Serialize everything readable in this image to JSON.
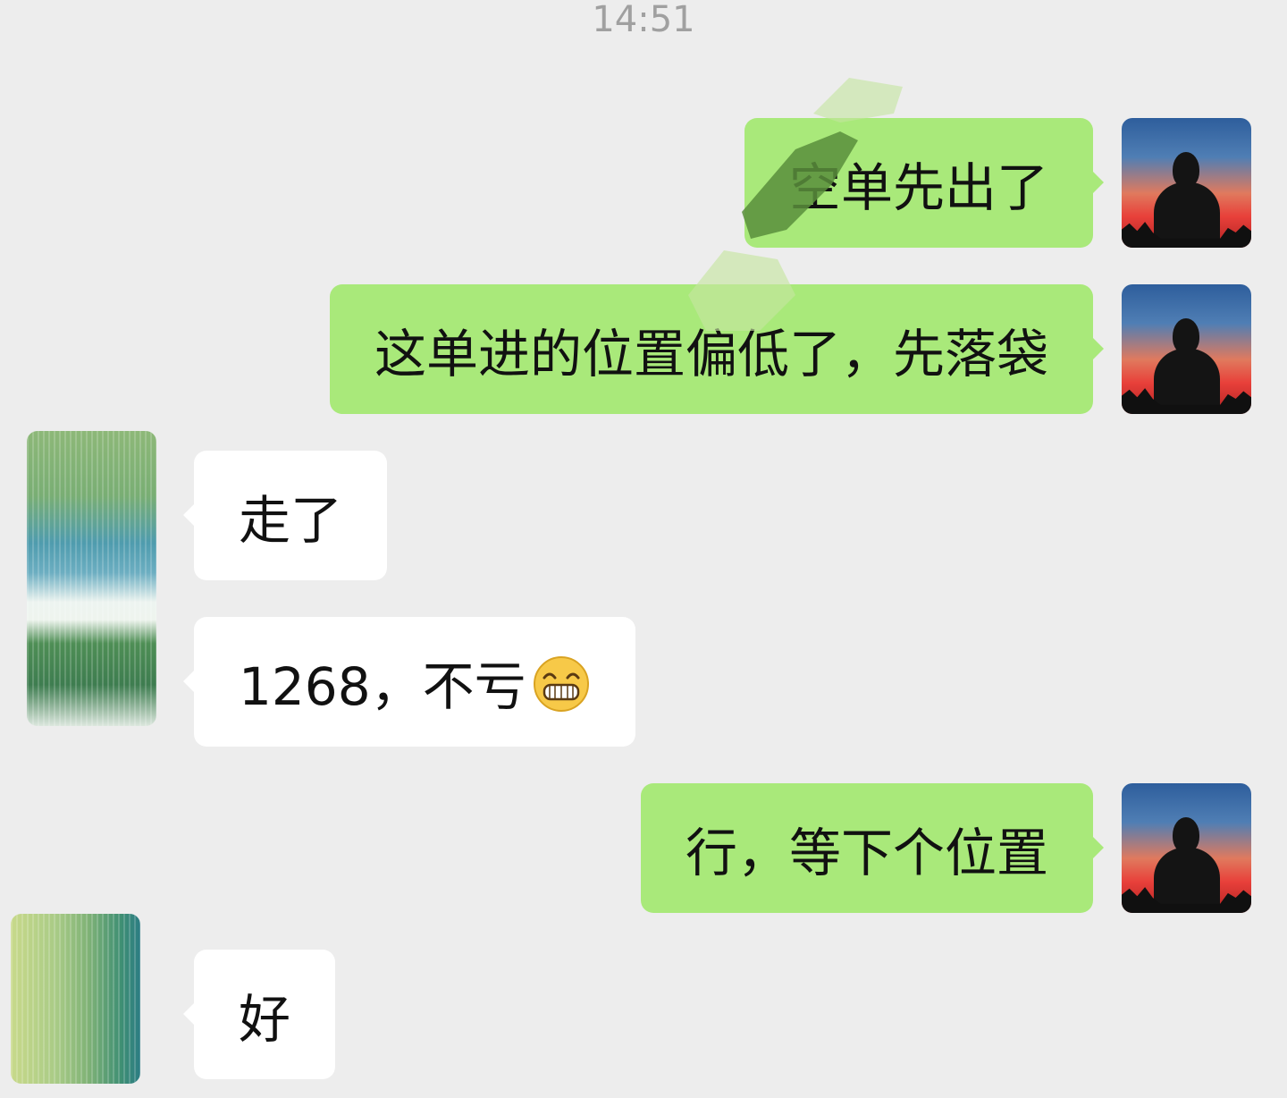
{
  "chat": {
    "timestamp": "14:51",
    "messages": [
      {
        "sender": "self",
        "text": "空单先出了"
      },
      {
        "sender": "self",
        "text": "这单进的位置偏低了，先落袋"
      },
      {
        "sender": "other",
        "text": "走了"
      },
      {
        "sender": "other",
        "text": "1268，不亏",
        "emoji": "grinning-face-emoji"
      },
      {
        "sender": "self",
        "text": "行，等下个位置"
      },
      {
        "sender": "other",
        "text": "好"
      }
    ]
  },
  "colors": {
    "background": "#EDEDED",
    "self_bubble": "#A9E97A",
    "other_bubble": "#FFFFFF",
    "timestamp": "#A0A0A0"
  }
}
